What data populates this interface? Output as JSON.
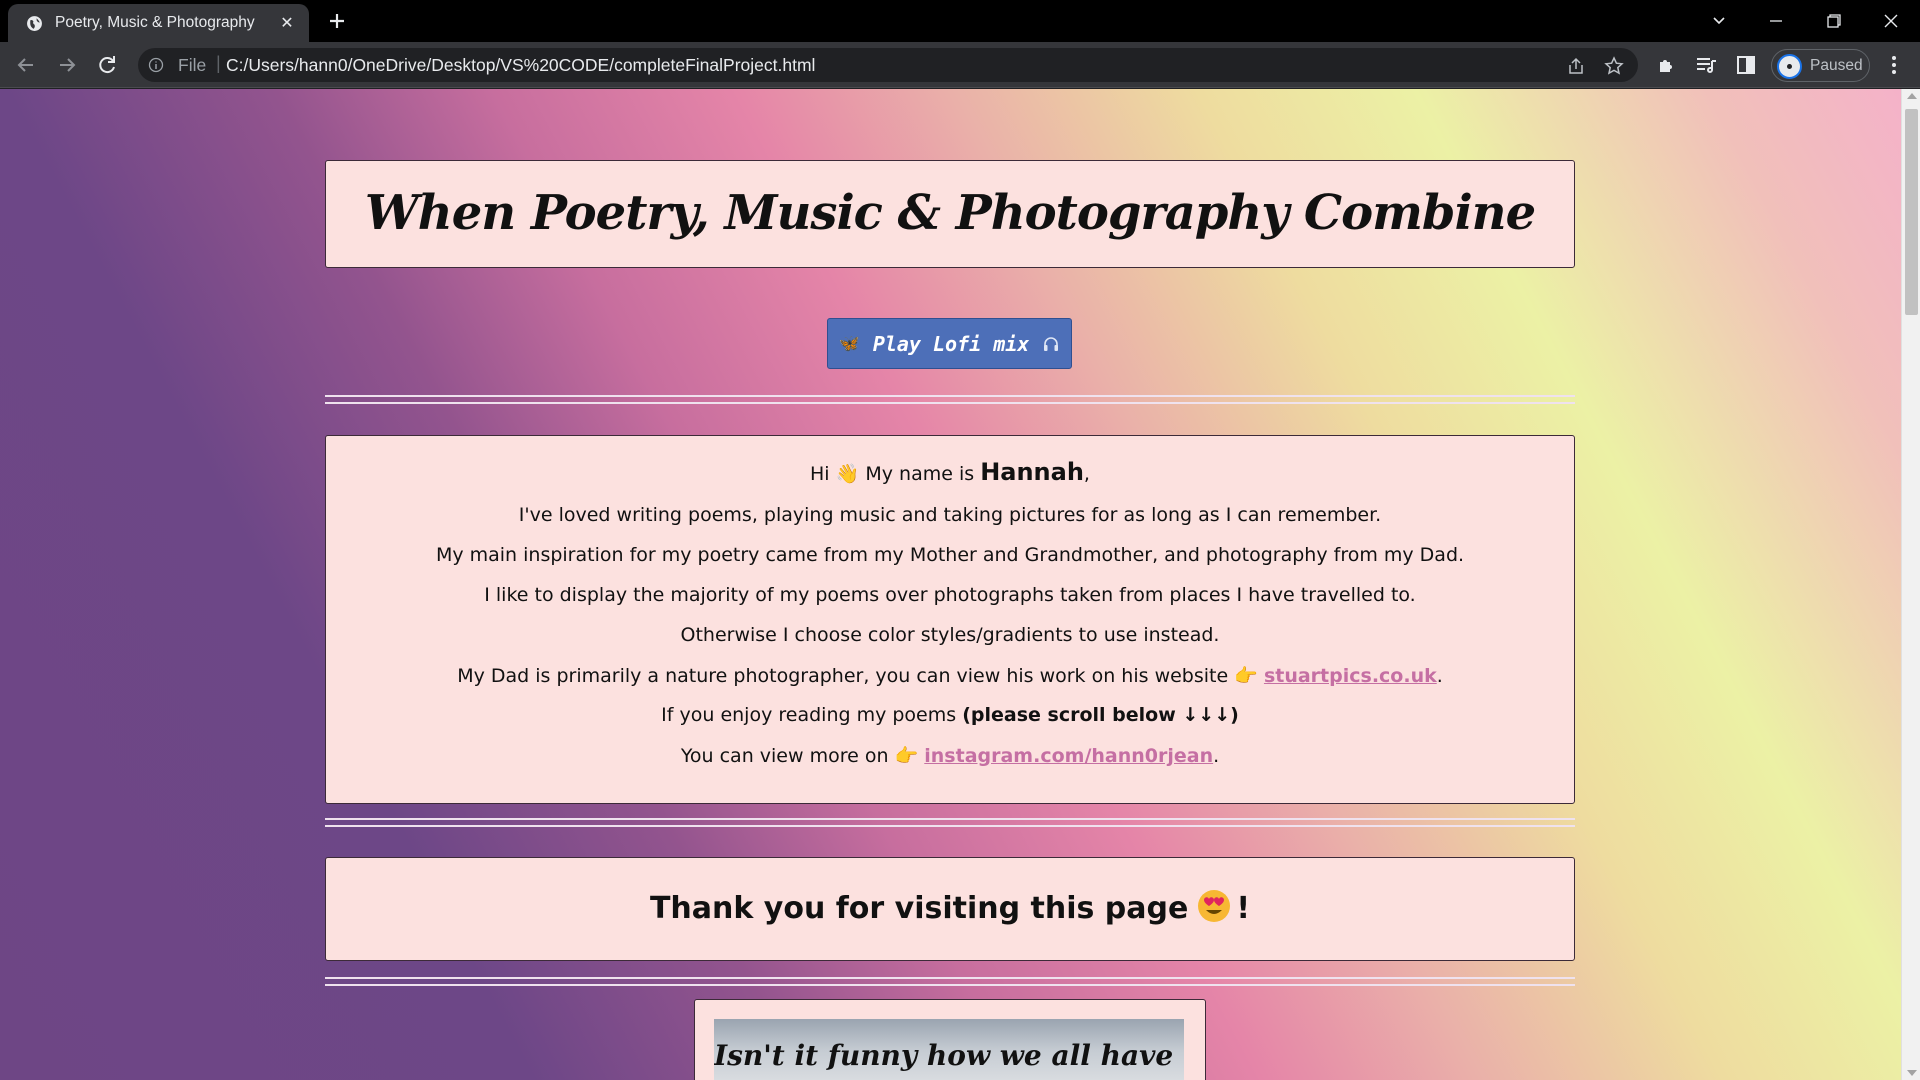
{
  "browser": {
    "tab_title": "Poetry, Music & Photography",
    "tab_close": "✕",
    "omnibox_scheme": "File",
    "omnibox_separator": "|",
    "url": "C:/Users/hann0/OneDrive/Desktop/VS%20CODE/completeFinalProject.html",
    "profile_status": "Paused"
  },
  "page": {
    "title": "When Poetry, Music & Photography Combine",
    "play_button": {
      "emoji_left": "🦋",
      "label": "Play Lofi mix",
      "icon_right": "headphones-icon"
    },
    "intro": {
      "greeting_pre": "Hi",
      "wave_emoji": "👋",
      "greeting_mid": "My name is",
      "name": "Hannah",
      "greeting_post": ",",
      "line2": "I've loved writing poems, playing music and taking pictures for as long as I can remember.",
      "line3": "My main inspiration for my poetry came from my Mother and Grandmother, and photography from my Dad.",
      "line4": "I like to display the majority of my poems over photographs taken from places I have travelled to.",
      "line5": "Otherwise I choose color styles/gradients to use instead.",
      "line6_pre": "My Dad is primarily a nature photographer, you can view his work on his website",
      "point_emoji": "👉",
      "dad_link": "stuartpics.co.uk",
      "period": ".",
      "line7_pre": "If you enjoy reading my poems",
      "line7_bold": "(please scroll below ↓↓↓)",
      "line8_pre": "You can view more on",
      "insta_link": "instagram.com/hann0rjean"
    },
    "thanks": {
      "text": "Thank you for visiting this page",
      "emoji": "heart-eyes-face-icon",
      "suffix": "!"
    },
    "poem_caption": "Isn't it funny how we all have the"
  },
  "colors": {
    "box_bg": "#fce1df",
    "button_bg": "#4d6fb8",
    "link": "#c56fa3",
    "gradient_start": "#6e4685",
    "gradient_mid": "#e585a8",
    "gradient_end": "#ecf1a5"
  }
}
